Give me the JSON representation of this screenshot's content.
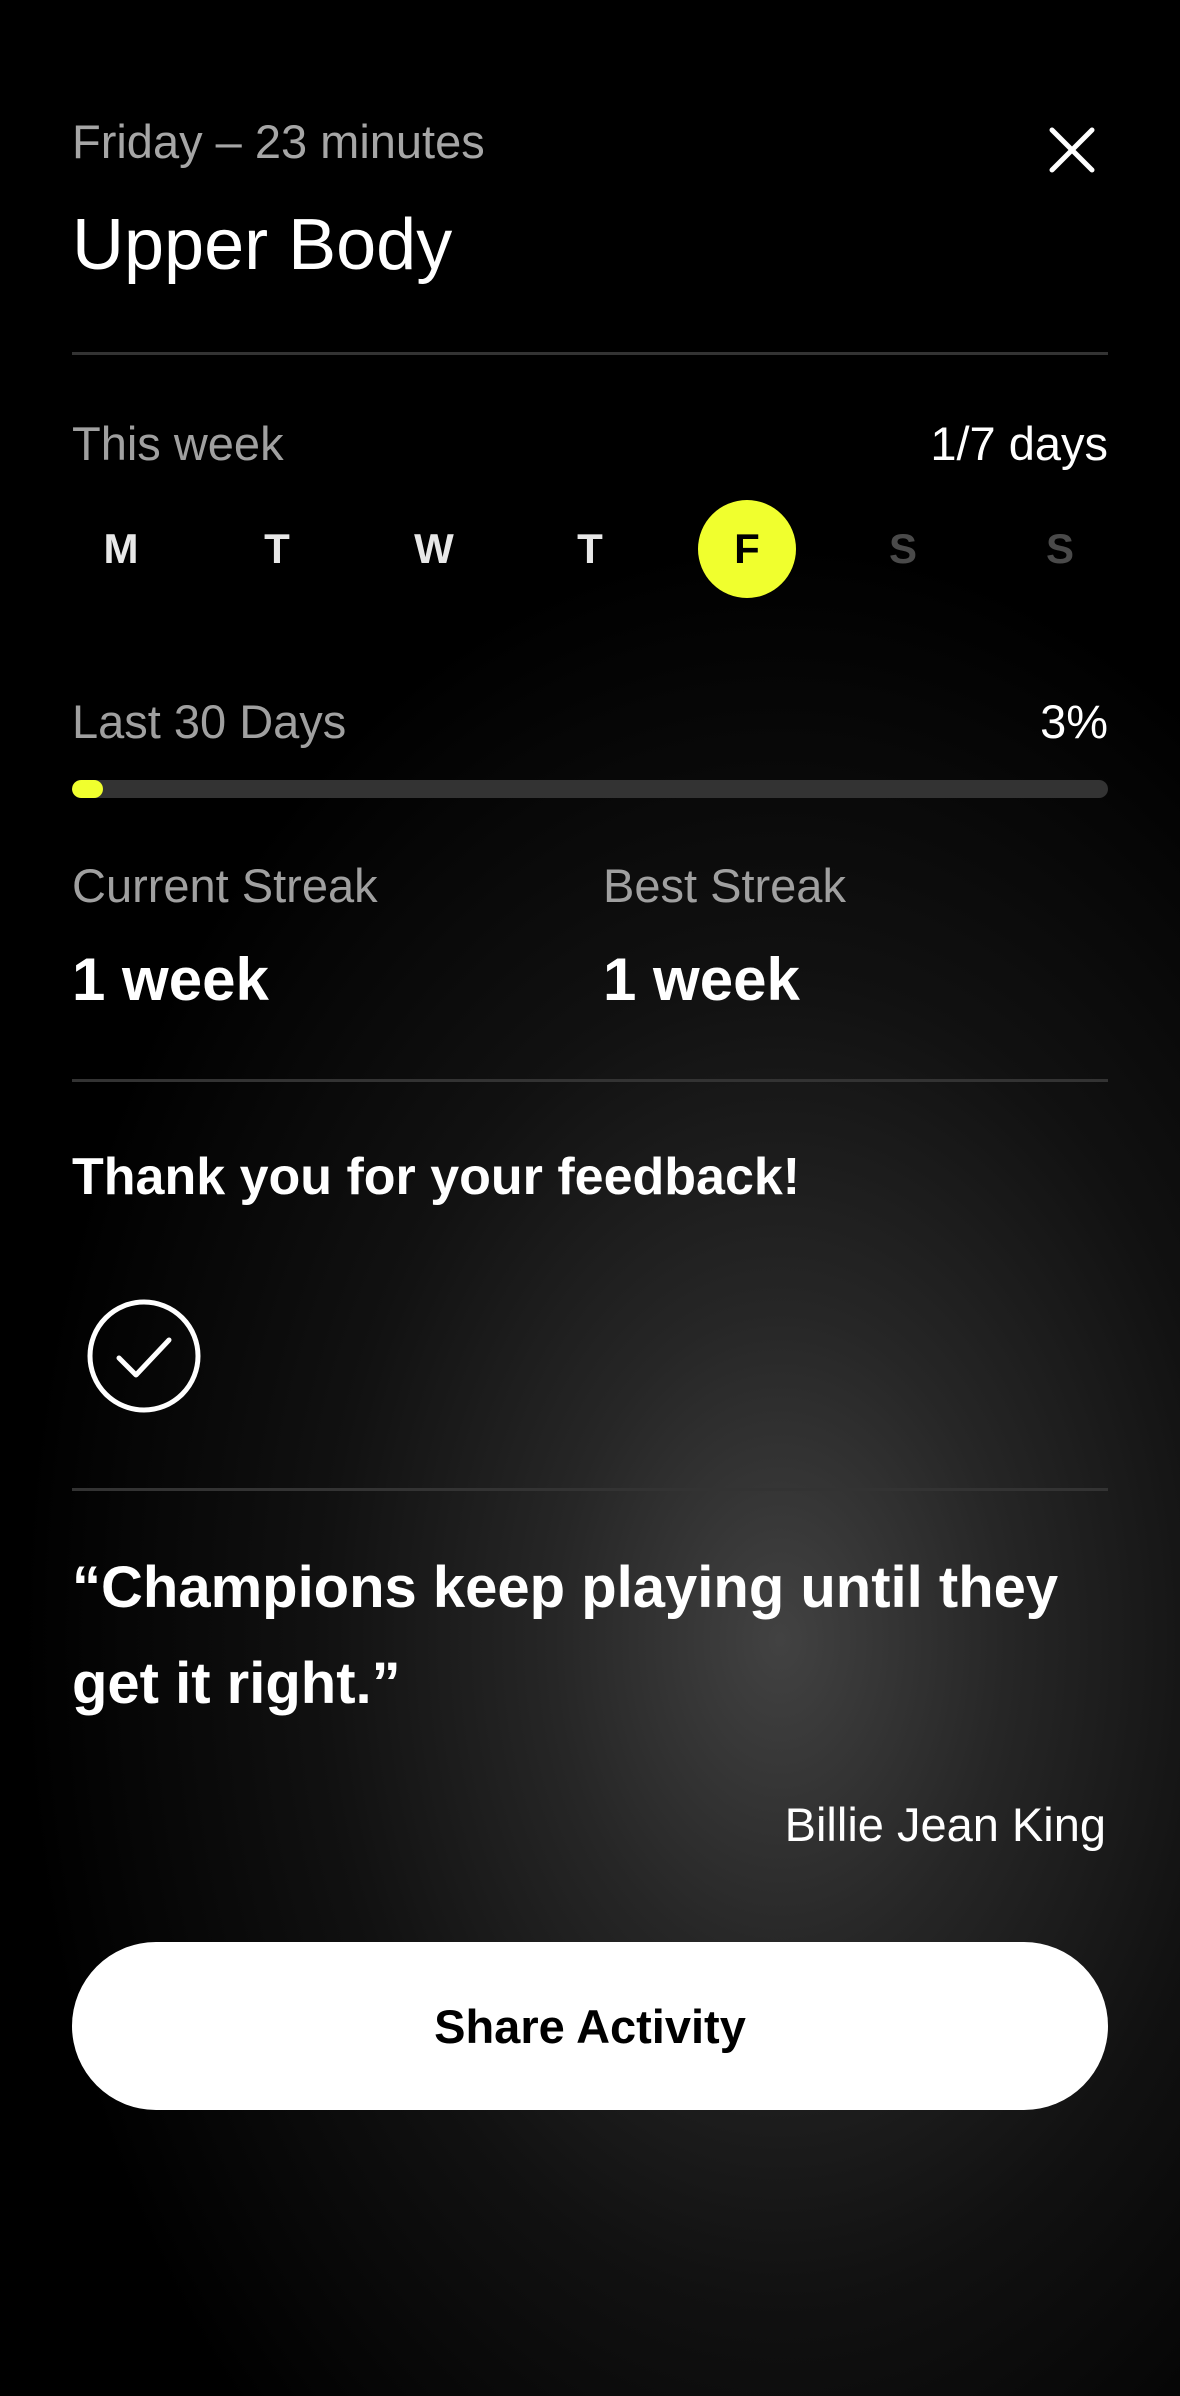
{
  "header": {
    "subtitle": "Friday – 23 minutes",
    "title": "Upper Body",
    "close_icon": "close-icon"
  },
  "week": {
    "label": "This week",
    "count": "1/7 days",
    "days": [
      {
        "letter": "M",
        "state": "past"
      },
      {
        "letter": "T",
        "state": "past"
      },
      {
        "letter": "W",
        "state": "past"
      },
      {
        "letter": "T",
        "state": "past"
      },
      {
        "letter": "F",
        "state": "active"
      },
      {
        "letter": "S",
        "state": "future"
      },
      {
        "letter": "S",
        "state": "future"
      }
    ]
  },
  "last30": {
    "label": "Last 30 Days",
    "percent_text": "3%",
    "progress_fraction": 0.03
  },
  "streaks": {
    "current_label": "Current Streak",
    "current_value": "1 week",
    "best_label": "Best Streak",
    "best_value": "1 week"
  },
  "feedback": {
    "message": "Thank you for your feedback!",
    "icon": "check-circle-icon"
  },
  "quote": {
    "text": "“Champions keep playing until they get it right.”",
    "author": "Billie Jean King"
  },
  "share": {
    "label": "Share Activity"
  },
  "colors": {
    "accent": "#f0ff2e",
    "background": "#000000",
    "text": "#ffffff",
    "muted": "#a0a0a0"
  }
}
